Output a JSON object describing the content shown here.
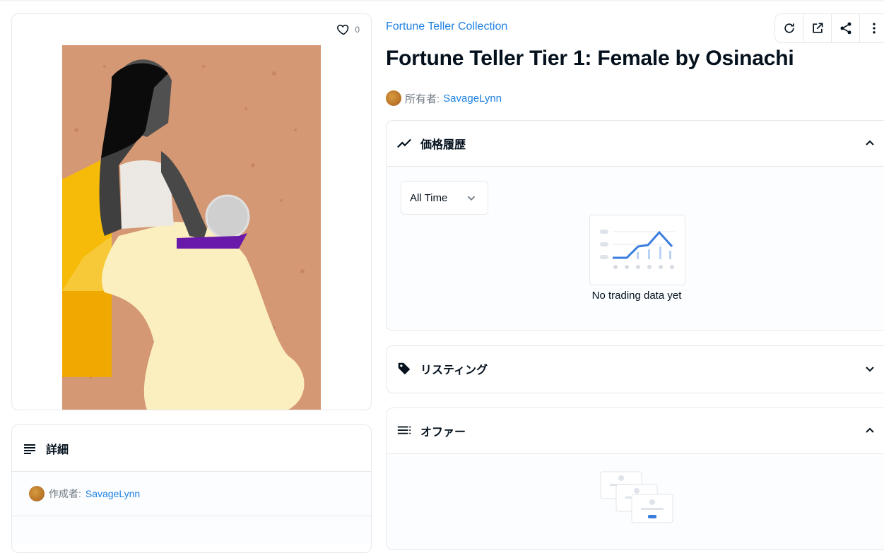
{
  "item": {
    "favorites_count": "0",
    "collection_name": "Fortune Teller Collection",
    "title": "Fortune Teller Tier 1: Female by Osinachi",
    "owner_label": "所有者:",
    "owner_name": "SavageLynn"
  },
  "toolbar": {
    "refresh_icon": "refresh-icon",
    "external_icon": "external-link-icon",
    "share_icon": "share-icon",
    "more_icon": "more-vertical-icon"
  },
  "details": {
    "header": "詳細",
    "creator_label": "作成者:",
    "creator_name": "SavageLynn"
  },
  "price_history": {
    "header": "価格履歴",
    "range_value": "All Time",
    "empty_text": "No trading data yet"
  },
  "listings": {
    "header": "リスティング"
  },
  "offers": {
    "header": "オファー"
  },
  "colors": {
    "link": "#2081e2",
    "border": "#e5e8eb",
    "text": "#04111d",
    "muted": "#707a83",
    "art_background": "#d59874",
    "chair": "#f6bb09",
    "dress": "#fbefbf"
  }
}
